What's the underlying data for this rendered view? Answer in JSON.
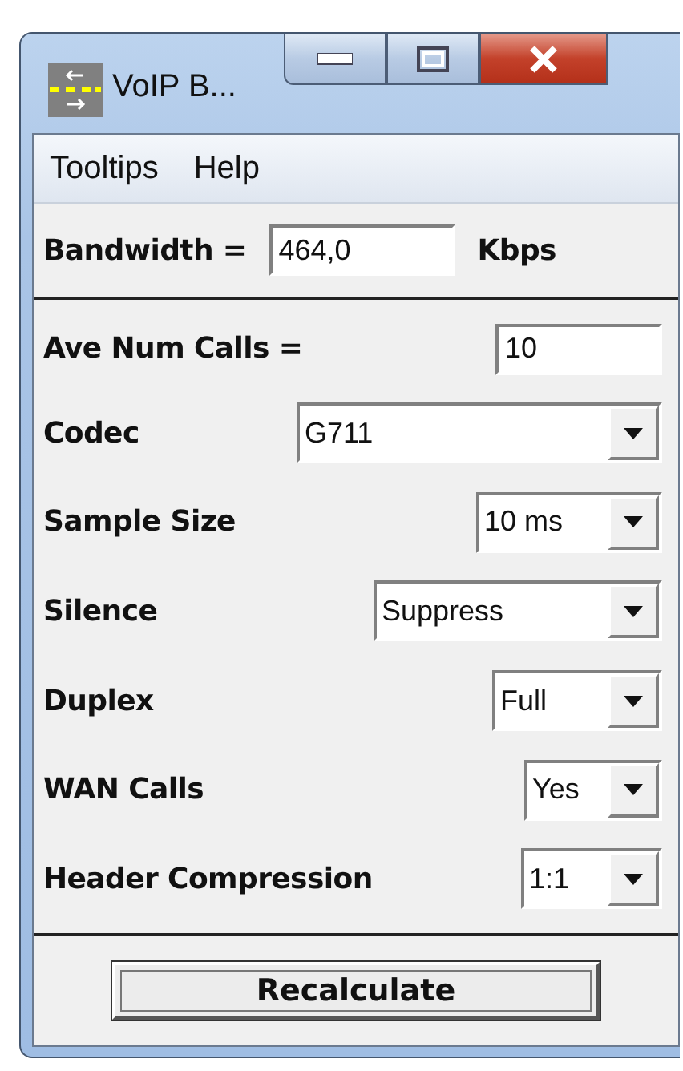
{
  "window": {
    "title": "VoIP B..."
  },
  "menu": [
    {
      "label": "Tooltips"
    },
    {
      "label": "Help"
    }
  ],
  "bandwidth": {
    "label": "Bandwidth =",
    "value": "464,0",
    "unit": "Kbps"
  },
  "fields": [
    {
      "kind": "text",
      "label": "Ave Num Calls =",
      "value": "10"
    },
    {
      "kind": "dropdown",
      "label": "Codec",
      "value": "G711"
    },
    {
      "kind": "dropdown",
      "label": "Sample Size",
      "value": "10 ms"
    },
    {
      "kind": "dropdown",
      "label": "Silence",
      "value": "Suppress"
    },
    {
      "kind": "dropdown",
      "label": "Duplex",
      "value": "Full"
    },
    {
      "kind": "dropdown",
      "label": "WAN Calls",
      "value": "Yes"
    },
    {
      "kind": "dropdown",
      "label": "Header Compression",
      "value": "1:1"
    }
  ],
  "button": {
    "label": "Recalculate"
  }
}
